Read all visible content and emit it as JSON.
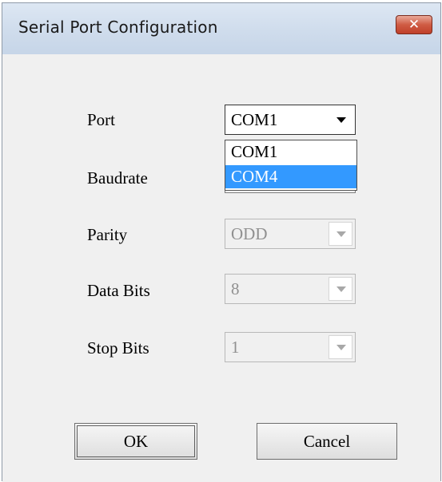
{
  "window": {
    "title": "Serial Port Configuration",
    "close_label": "✕"
  },
  "form": {
    "port": {
      "label": "Port",
      "value": "COM1"
    },
    "baudrate": {
      "label": "Baudrate"
    },
    "parity": {
      "label": "Parity",
      "value": "ODD"
    },
    "data_bits": {
      "label": "Data Bits",
      "value": "8"
    },
    "stop_bits": {
      "label": "Stop Bits",
      "value": "1"
    }
  },
  "port_dropdown": {
    "options": [
      "COM1",
      "COM4"
    ],
    "highlighted": "COM4"
  },
  "buttons": {
    "ok": "OK",
    "cancel": "Cancel"
  },
  "colors": {
    "selection": "#3399ff",
    "close_button": "#c8452f",
    "title_bar": "#d4e0ef"
  },
  "icons": {
    "dropdown_arrow": "chevron-down-icon",
    "close": "close-icon"
  }
}
